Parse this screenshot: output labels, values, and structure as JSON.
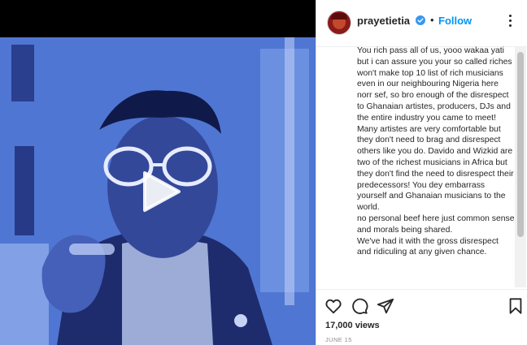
{
  "post": {
    "username": "prayetietia",
    "follow_label": "Follow",
    "separator": "•",
    "caption": "You rich pass all of us, yooo wakaa yati but i can assure you your so called riches won't make top 10 list of rich musicians even in our neighbouring Nigeria here norr sef, so bro enough of the disrespect to Ghanaian artistes, producers, DJs and the entire industry you came to meet! Many artistes are very comfortable but they don't need to brag and disrespect others like you do. Davido and Wizkid are two of the richest musicians in Africa but they don't find the need to disrespect their predecessors! You dey embarrass yourself and Ghanaian musicians to the world.\nno personal beef here just common sense and morals being shared.\nWe've had it with the gross disrespect and ridiculing at any given chance.",
    "views": "17,000 views",
    "date": "JUNE 15"
  },
  "icons": {
    "verified": "verified-badge-icon",
    "more": "more-options-icon",
    "play": "play-icon",
    "like": "heart-icon",
    "comment": "comment-icon",
    "share": "share-icon",
    "save": "bookmark-icon"
  },
  "colors": {
    "accent": "#0095f6",
    "text": "#262626",
    "muted": "#8e8e8e",
    "video_tint": "#4f7fd8"
  }
}
